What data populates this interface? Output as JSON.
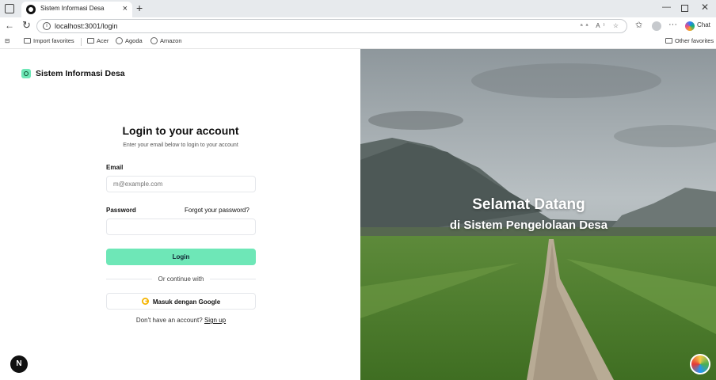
{
  "browser": {
    "tab_title": "Sistem Informasi Desa",
    "tab_close": "×",
    "new_tab": "+",
    "url": "localhost:3001/login",
    "address_icons": "ᵃᵃ A⁾ ☆",
    "chat_label": "Chat",
    "window_min": "—",
    "window_close": "✕",
    "favorites": [
      {
        "label": "Import favorites",
        "icon": "folder-icon"
      },
      {
        "label": "Acer",
        "icon": "folder-icon"
      },
      {
        "label": "Agoda",
        "icon": "globe-icon"
      },
      {
        "label": "Amazon",
        "icon": "globe-icon"
      }
    ],
    "other_favorites": "Other favorites"
  },
  "brand": {
    "name": "Sistem Informasi Desa",
    "logo_color": "#6ee7b7"
  },
  "login": {
    "title": "Login to your account",
    "subtitle": "Enter your email below to login to your account",
    "email_label": "Email",
    "email_placeholder": "m@example.com",
    "password_label": "Password",
    "forgot_link": "Forgot your password?",
    "login_button": "Login",
    "divider_text": "Or continue with",
    "google_button": "Masuk dengan Google",
    "signup_prompt": "Don't have an account?",
    "signup_link": "Sign up",
    "accent_color": "#6ee7b7"
  },
  "hero": {
    "title": "Selamat Datang",
    "subtitle": "di Sistem Pengelolaan Desa"
  },
  "dev": {
    "badge": "N"
  }
}
